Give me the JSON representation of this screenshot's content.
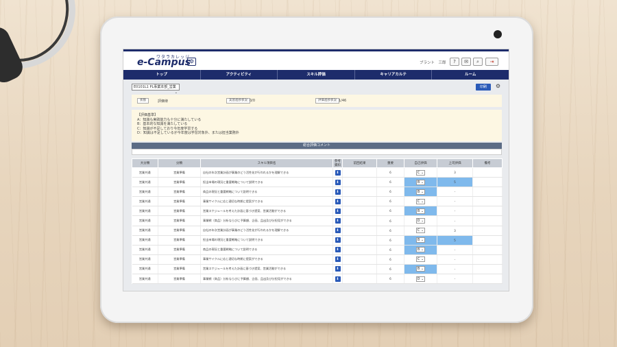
{
  "app": {
    "logo_kana": "ワタラカレッジ",
    "logo": "e-Campus",
    "user": "ブラント　三郎"
  },
  "nav": [
    "トップ",
    "アクティビティ",
    "スキル評価",
    "キャリアカルテ",
    "ルーム"
  ],
  "toolbar": {
    "department": "E0101L1 PL事業本部_営業",
    "print": "印刷"
  },
  "info": {
    "status_label": "状態",
    "status_value": "評価待",
    "self_eval_label": "実習進捗状況",
    "self_eval_value": "0/0",
    "eval_label": "評価進捗状況",
    "eval_value": "1/46"
  },
  "legend": {
    "title": "【評価基準】",
    "lines": [
      "A：知識も実践能力も十分に満たしている",
      "B：基本的な知識を満たしている",
      "C：知識が不足しており今年度学習する",
      "D：知識は不足しているが今年度は学習対象外、または担当業務外"
    ]
  },
  "comment_header": "総合評価コメント",
  "table": {
    "headers": [
      "大分類",
      "分類",
      "スキル項目名",
      "参考資料",
      "前回結果",
      "重要",
      "自己評価",
      "上司評価",
      "備考"
    ],
    "rows": [
      {
        "major": "営業共通",
        "minor": "営業準備",
        "skill": "自社の年次営業計画が事業のどう活性化が行われるかを理解できる",
        "prev": "",
        "weight": "6",
        "self": "C",
        "boss": "3",
        "self_hl": false,
        "boss_hl": false
      },
      {
        "major": "営業共通",
        "minor": "営業準備",
        "skill": "担当市場の現況と重要戦略について説明できる",
        "prev": "",
        "weight": "6",
        "self": "B",
        "boss": "5",
        "self_hl": true,
        "boss_hl": true
      },
      {
        "major": "営業共通",
        "minor": "営業準備",
        "skill": "商品の現況と重要戦略について説明できる",
        "prev": "",
        "weight": "6",
        "self": "B",
        "boss": "-",
        "self_hl": true,
        "boss_hl": false
      },
      {
        "major": "営業共通",
        "minor": "営業準備",
        "skill": "事業サイクルに応じ適切な時期に提案ができる",
        "prev": "",
        "weight": "6",
        "self": "C",
        "boss": "-",
        "self_hl": false,
        "boss_hl": false
      },
      {
        "major": "営業共通",
        "minor": "営業準備",
        "skill": "営業スケジュールを考えた計画に基づき提案、営業活動ができる",
        "prev": "",
        "weight": "6",
        "self": "B",
        "boss": "-",
        "self_hl": true,
        "boss_hl": false
      },
      {
        "major": "営業共通",
        "minor": "営業準備",
        "skill": "事業戦（商品）分析ならびに予算額、企画、品出及び分担見ができる",
        "prev": "",
        "weight": "6",
        "self": "D",
        "boss": "-",
        "self_hl": false,
        "boss_hl": false
      },
      {
        "major": "営業共通",
        "minor": "営業準備",
        "skill": "自社の年次営業計画が事業のどう活性化が行われるかを理解できる",
        "prev": "",
        "weight": "6",
        "self": "C",
        "boss": "3",
        "self_hl": false,
        "boss_hl": false
      },
      {
        "major": "営業共通",
        "minor": "営業準備",
        "skill": "担当市場の現況と重要戦略について説明できる",
        "prev": "",
        "weight": "6",
        "self": "B",
        "boss": "5",
        "self_hl": true,
        "boss_hl": true
      },
      {
        "major": "営業共通",
        "minor": "営業準備",
        "skill": "商品の現況と重要戦略について説明できる",
        "prev": "",
        "weight": "6",
        "self": "B",
        "boss": "-",
        "self_hl": true,
        "boss_hl": false
      },
      {
        "major": "営業共通",
        "minor": "営業準備",
        "skill": "事業サイクルに応じ適切な時期に提案ができる",
        "prev": "",
        "weight": "6",
        "self": "C",
        "boss": "-",
        "self_hl": false,
        "boss_hl": false
      },
      {
        "major": "営業共通",
        "minor": "営業準備",
        "skill": "営業スケジュールを考えた計画に基づき提案、営業活動ができる",
        "prev": "",
        "weight": "6",
        "self": "B",
        "boss": "-",
        "self_hl": true,
        "boss_hl": false
      },
      {
        "major": "営業共通",
        "minor": "営業準備",
        "skill": "事業戦（商品）分析ならびに予算額、企画、品出及び分担見ができる",
        "prev": "",
        "weight": "6",
        "self": "D",
        "boss": "-",
        "self_hl": false,
        "boss_hl": false
      }
    ]
  }
}
